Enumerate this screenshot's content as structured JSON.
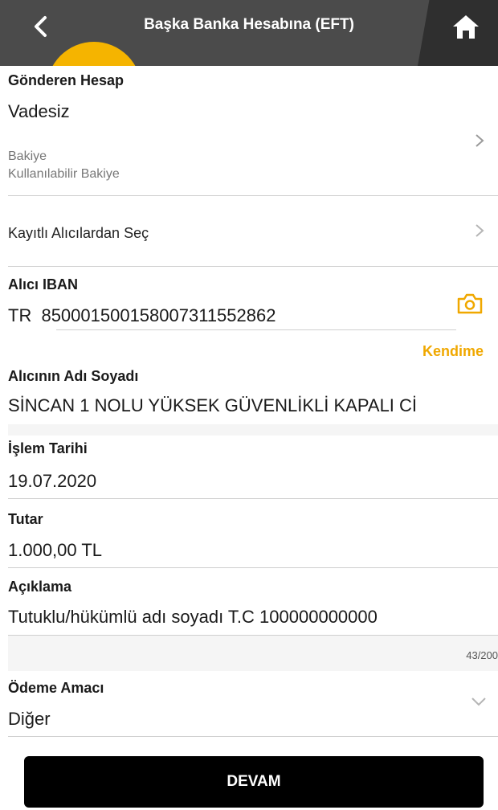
{
  "header": {
    "title": "Başka Banka Hesabına (EFT)",
    "icons": {
      "back": "chevron-left-icon",
      "home": "home-icon"
    },
    "accent": "#f5b400"
  },
  "sender": {
    "label": "Gönderen Hesap",
    "account_type": "Vadesiz",
    "balance_label": "Bakiye",
    "available_label": "Kullanılabilir Bakiye"
  },
  "saved_recipients": {
    "label": "Kayıtlı Alıcılardan Seç"
  },
  "iban": {
    "label": "Alıcı IBAN",
    "prefix": "TR",
    "value": "850001500158007311552862",
    "self_link": "Kendime"
  },
  "recipient_name": {
    "label": "Alıcının Adı Soyadı",
    "value": "SİNCAN 1 NOLU YÜKSEK GÜVENLİKLİ KAPALI Cİ"
  },
  "date": {
    "label": "İşlem Tarihi",
    "value": "19.07.2020"
  },
  "amount": {
    "label": "Tutar",
    "value": "1.000,00 TL"
  },
  "description": {
    "label": "Açıklama",
    "value": "Tutuklu/hükümlü adı soyadı T.C 100000000000",
    "counter": "43/200"
  },
  "purpose": {
    "label": "Ödeme Amacı",
    "value": "Diğer"
  },
  "continue_button": {
    "label": "DEVAM"
  },
  "colors": {
    "header_bg": "#4b4b4b",
    "accent": "#f0a800",
    "button_bg": "#000000"
  }
}
